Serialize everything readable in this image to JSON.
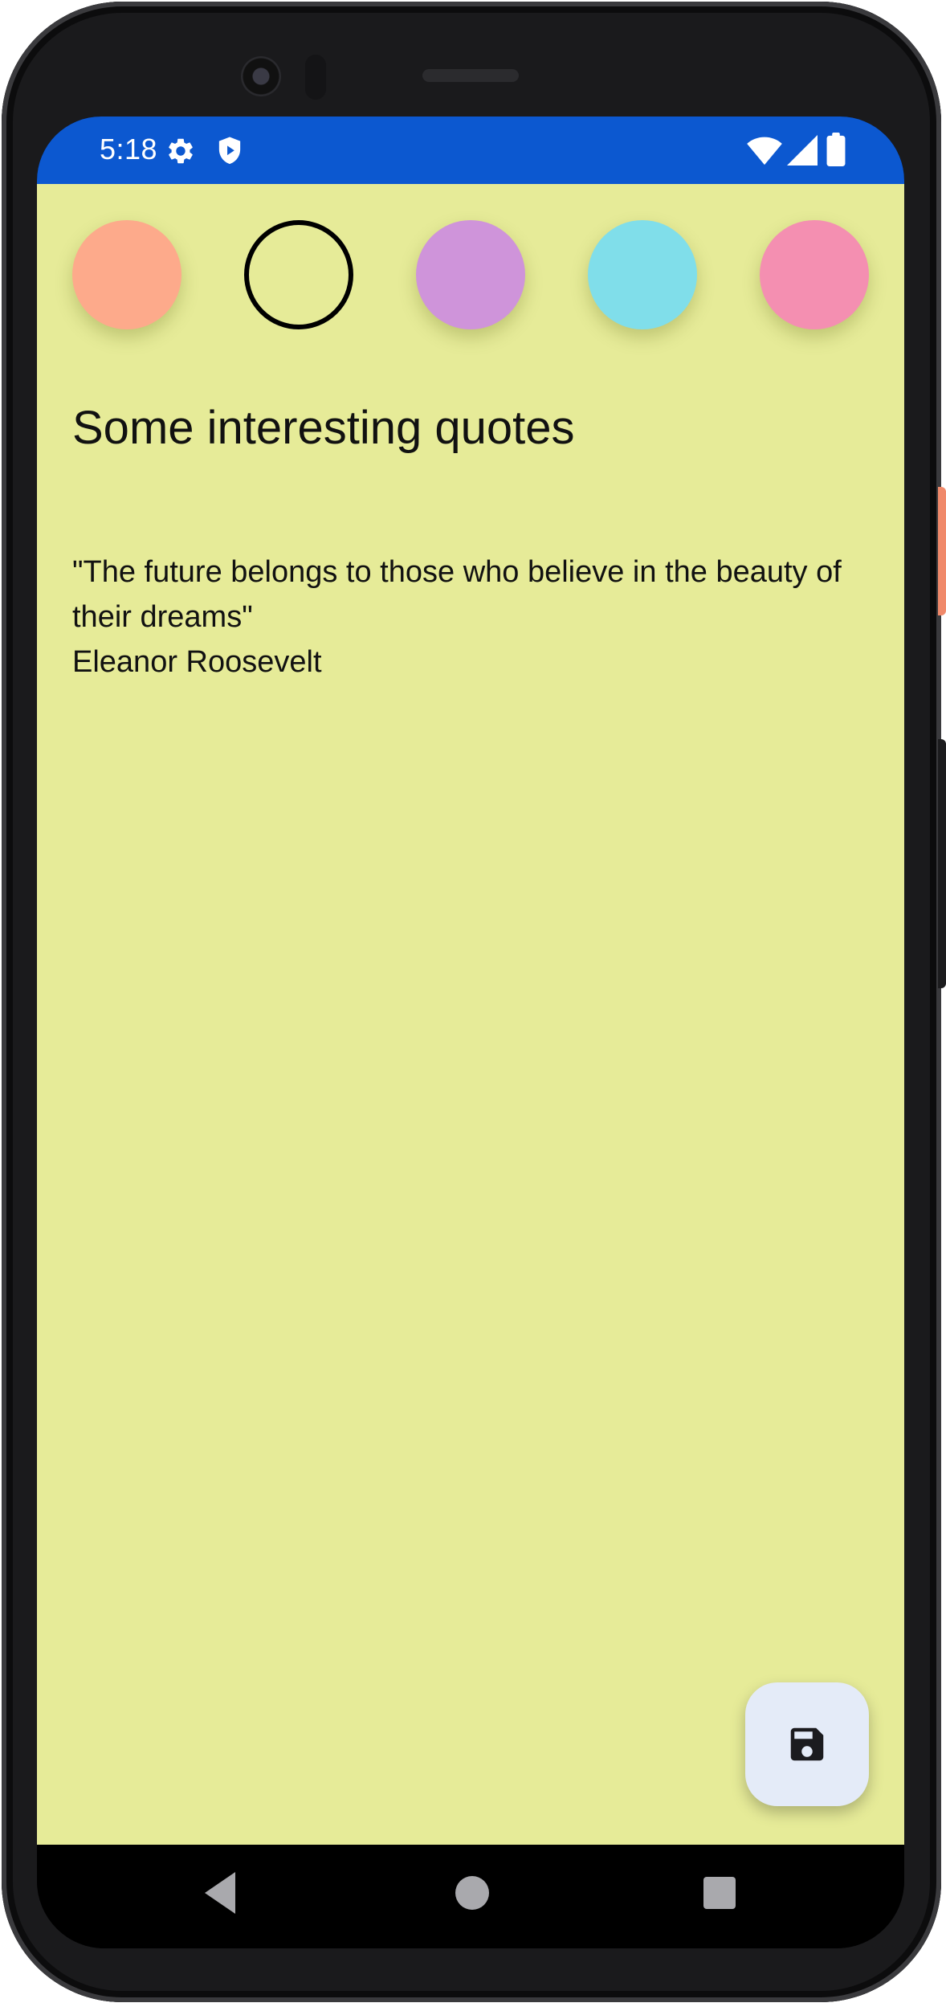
{
  "status_bar": {
    "time": "5:18",
    "background": "#0c58d0",
    "left_icons": [
      "settings-gear-icon",
      "shield-play-icon"
    ],
    "right_icons": [
      "wifi-icon",
      "cellular-signal-icon",
      "battery-icon"
    ]
  },
  "color_picker": {
    "swatches": [
      {
        "color": "#fdaa8b",
        "selected": false
      },
      {
        "color": "#e6eb98",
        "selected": true
      },
      {
        "color": "#cf94da",
        "selected": false
      },
      {
        "color": "#80deea",
        "selected": false
      },
      {
        "color": "#f48fb1",
        "selected": false
      }
    ]
  },
  "note": {
    "title": "Some interesting quotes",
    "body": "\"The future belongs to those who believe in the beauty of their dreams\"\nEleanor Roosevelt",
    "background": "#e6eb98"
  },
  "fab": {
    "icon": "save-floppy-icon",
    "background": "#e4ebf8"
  },
  "nav_bar": {
    "buttons": [
      "back-triangle-icon",
      "home-circle-icon",
      "recents-square-icon"
    ]
  }
}
